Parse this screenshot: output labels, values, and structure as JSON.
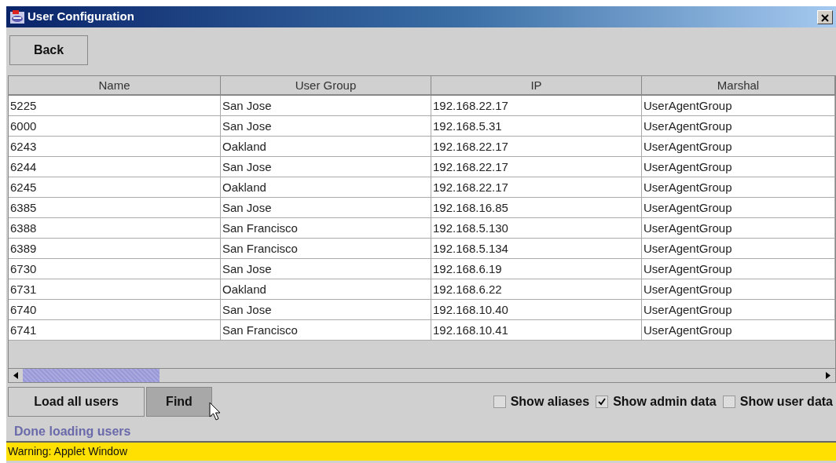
{
  "window": {
    "title": "User Configuration"
  },
  "toolbar": {
    "buttons": [
      "Back"
    ]
  },
  "table": {
    "columns": [
      "Name",
      "User Group",
      "IP",
      "Marshal"
    ],
    "rows": [
      [
        "5225",
        "San Jose",
        "192.168.22.17",
        "UserAgentGroup"
      ],
      [
        "6000",
        "San Jose",
        "192.168.5.31",
        "UserAgentGroup"
      ],
      [
        "6243",
        "Oakland",
        "192.168.22.17",
        "UserAgentGroup"
      ],
      [
        "6244",
        "San Jose",
        "192.168.22.17",
        "UserAgentGroup"
      ],
      [
        "6245",
        "Oakland",
        "192.168.22.17",
        "UserAgentGroup"
      ],
      [
        "6385",
        "San Jose",
        "192.168.16.85",
        "UserAgentGroup"
      ],
      [
        "6388",
        "San Francisco",
        "192.168.5.130",
        "UserAgentGroup"
      ],
      [
        "6389",
        "San Francisco",
        "192.168.5.134",
        "UserAgentGroup"
      ],
      [
        "6730",
        "San Jose",
        "192.168.6.19",
        "UserAgentGroup"
      ],
      [
        "6731",
        "Oakland",
        "192.168.6.22",
        "UserAgentGroup"
      ],
      [
        "6740",
        "San Jose",
        "192.168.10.40",
        "UserAgentGroup"
      ],
      [
        "6741",
        "San Francisco",
        "192.168.10.41",
        "UserAgentGroup"
      ]
    ]
  },
  "actions": [
    {
      "label": "Load all users",
      "pressed": false
    },
    {
      "label": "Find",
      "pressed": true
    }
  ],
  "options": [
    {
      "label": "Show aliases",
      "checked": false
    },
    {
      "label": "Show admin data",
      "checked": true
    },
    {
      "label": "Show user data",
      "checked": false
    }
  ],
  "status": "Done loading users",
  "warning": "Warning: Applet Window"
}
